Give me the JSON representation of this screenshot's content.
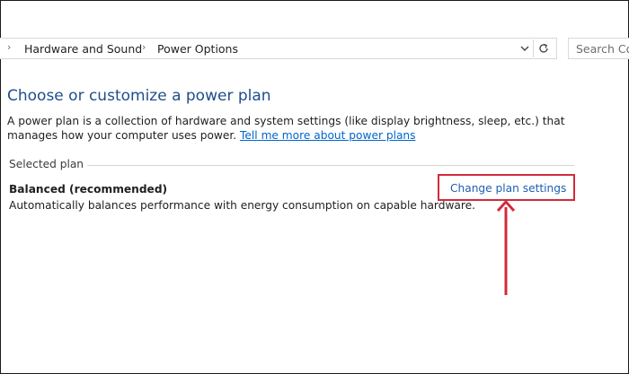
{
  "breadcrumb": {
    "items": [
      "Hardware and Sound",
      "Power Options"
    ]
  },
  "search": {
    "placeholder": "Search Co"
  },
  "main": {
    "title": "Choose or customize a power plan",
    "description": "A power plan is a collection of hardware and system settings (like display brightness, sleep, etc.) that manages how your computer uses power.",
    "learn_more_link": "Tell me more about power plans",
    "group_label": "Selected plan",
    "plan": {
      "name": "Balanced (recommended)",
      "description": "Automatically balances performance with energy consumption on capable hardware.",
      "change_link": "Change plan settings"
    }
  },
  "icons": {
    "breadcrumb_separator": "chevron-right-icon",
    "address_dropdown": "chevron-down-icon",
    "refresh": "refresh-icon",
    "annotation_arrow": "arrow-up-icon"
  },
  "colors": {
    "title": "#1e4e8c",
    "link": "#0066cc",
    "annotation": "#d12b3a"
  }
}
